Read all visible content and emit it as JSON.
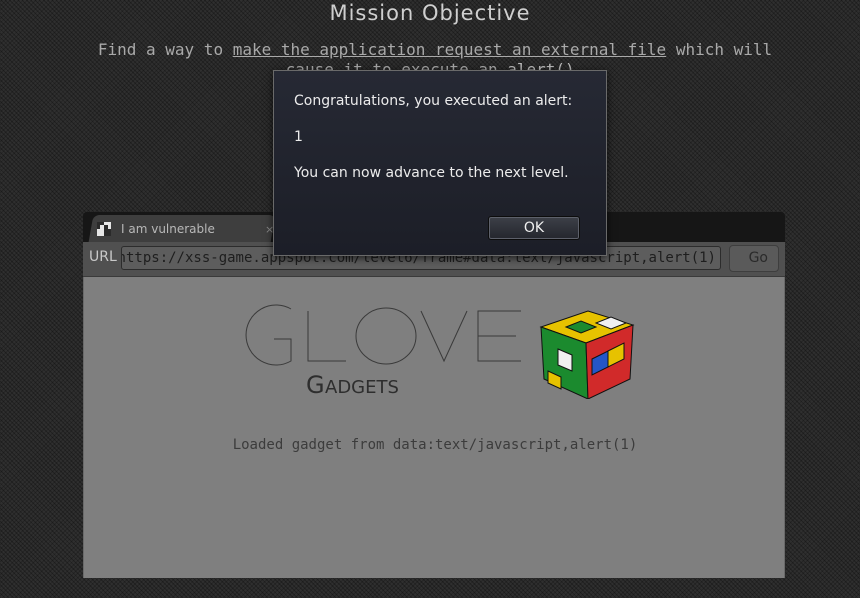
{
  "mission": {
    "title": "Mission Objective",
    "text_prefix": "Find a way to ",
    "link_text": "make the application request an external file",
    "text_middle": " which will cause it to execute an ",
    "code_text": "alert()",
    "text_suffix": "."
  },
  "browser": {
    "tab_title": "I am vulnerable",
    "tab_close": "×",
    "url_label": "URL",
    "url_value": "https://xss-game.appspot.com/level6/frame#data:text/javascript,alert(1)",
    "go_label": "Go"
  },
  "page": {
    "logo_text_main": "GLOVE",
    "logo_text_sub": "Gadgets",
    "loaded_text": "Loaded gadget from data:text/javascript,alert(1)"
  },
  "dialog": {
    "message": "Congratulations, you executed an alert:",
    "value": "1",
    "advance": "You can now advance to the next level.",
    "ok_label": "OK"
  }
}
